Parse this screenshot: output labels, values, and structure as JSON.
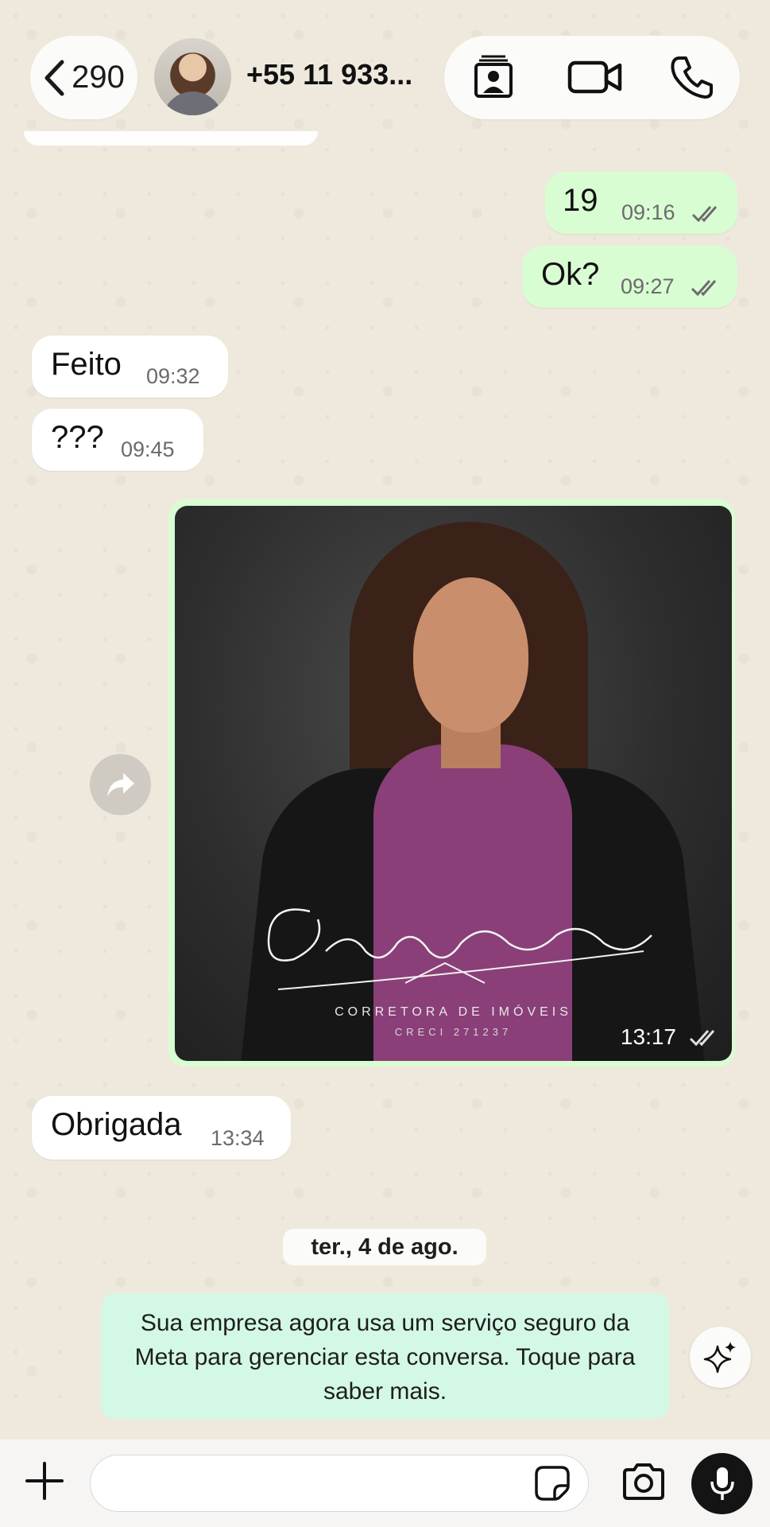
{
  "header": {
    "back_count": "290",
    "contact_name": "+55 11 933...",
    "icons": [
      "chevron-left-icon",
      "contact-card-icon",
      "video-camera-icon",
      "phone-icon"
    ]
  },
  "messages": [
    {
      "direction": "out",
      "text": "19",
      "time": "09:16",
      "status": "read"
    },
    {
      "direction": "out",
      "text": "Ok?",
      "time": "09:27",
      "status": "read"
    },
    {
      "direction": "in",
      "text": "Feito",
      "time": "09:32"
    },
    {
      "direction": "in",
      "text": "???",
      "time": "09:45"
    },
    {
      "direction": "out",
      "type": "image",
      "time": "13:17",
      "status": "read",
      "image_text": {
        "signature": "Jessyca Pizano",
        "line1": "CORRETORA DE IMÓVEIS",
        "line2": "CRECI 271237"
      }
    },
    {
      "direction": "in",
      "text": "Obrigada",
      "time": "13:34"
    }
  ],
  "date_separator": "ter., 4 de ago.",
  "system_notice": "Sua empresa agora usa um serviço seguro da Meta para gerenciar esta conversa. Toque para saber mais.",
  "composer": {
    "input_value": "",
    "icons": [
      "plus-icon",
      "sticker-icon",
      "camera-icon",
      "microphone-icon",
      "ai-sparkle-icon",
      "share-forward-icon"
    ]
  },
  "colors": {
    "outgoing_bubble": "#d9fdd3",
    "incoming_bubble": "#ffffff",
    "system_notice_bg": "#d3f8e6",
    "wallpaper": "#efe9dd",
    "read_ticks": "#6b6b6b"
  }
}
